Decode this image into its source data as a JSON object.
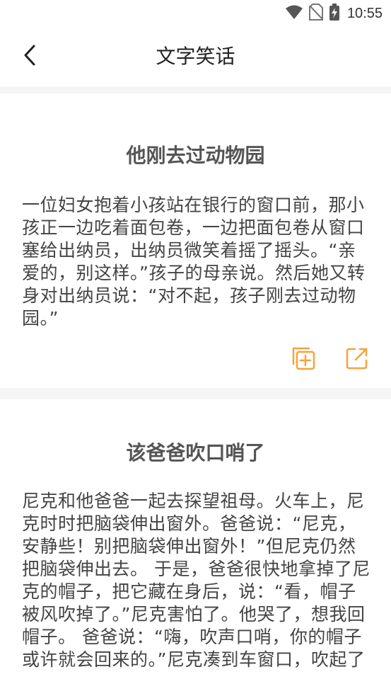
{
  "status_bar": {
    "time": "10:55",
    "icons": [
      "wifi-icon",
      "no-sim-icon",
      "battery-charging-icon"
    ]
  },
  "nav": {
    "title": "文字笑话",
    "back_icon": "chevron-left-icon"
  },
  "jokes": [
    {
      "title": "他刚去过动物园",
      "body": "一位妇女抱着小孩站在银行的窗口前，那小孩正一边吃着面包卷，一边把面包卷从窗口塞给出纳员，出纳员微笑着摇了摇头。“亲爱的，别这样。”孩子的母亲说。然后她又转身对出纳员说：“对不起，孩子刚去过动物园。”",
      "actions": [
        "copy-add-icon",
        "share-icon"
      ]
    },
    {
      "title": "该爸爸吹口哨了",
      "body": "尼克和他爸爸一起去探望祖母。火车上，尼克时时把脑袋伸出窗外。爸爸说：“尼克，安静些！别把脑袋伸出窗外！”但尼克仍然把脑袋伸出去。 于是，爸爸很快地拿掉了尼克的帽子，把它藏在身后，说：“看，帽子被风吹掉了。”尼克害怕了。他哭了，想我回帽子。 爸爸说：“嗨，吹声口哨，你的帽子或许就会回来的。”尼克凑到车窗口，吹起了"
    }
  ],
  "colors": {
    "accent": "#f5a33b",
    "background": "#f5f5f5",
    "card": "#ffffff"
  }
}
